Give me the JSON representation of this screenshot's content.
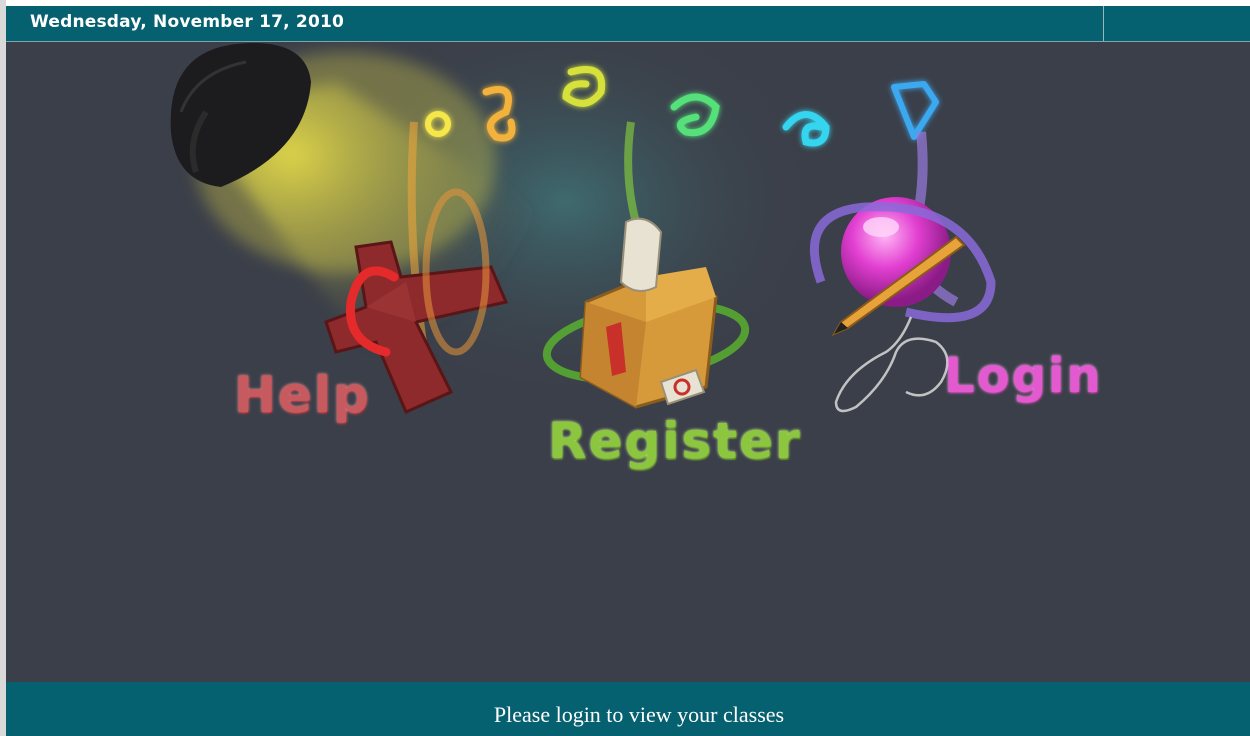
{
  "header": {
    "date": "Wednesday, November 17, 2010"
  },
  "nav": {
    "help_label": "Help",
    "register_label": "Register",
    "login_label": "Login"
  },
  "footer": {
    "message": "Please login to view your classes"
  },
  "colors": {
    "bar": "#05606f",
    "background": "#3b3f49",
    "help": "#c75a5e",
    "register": "#8cc63f",
    "login": "#e35ad0"
  }
}
